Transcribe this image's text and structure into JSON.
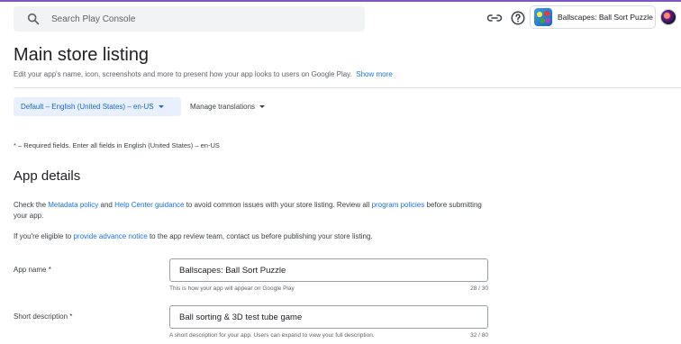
{
  "header": {
    "search_placeholder": "Search Play Console",
    "app_name": "Ballscapes: Ball Sort Puzzle"
  },
  "page": {
    "title": "Main store listing",
    "subtitle": "Edit your app's name, icon, screenshots and more to present how your app looks to users on Google Play.",
    "show_more": "Show more"
  },
  "language": {
    "selected": "Default – English (United States) – en-US",
    "manage_translations": "Manage translations"
  },
  "required_note": "* – Required fields. Enter all fields in English (United States) – en-US",
  "app_details": {
    "heading": "App details",
    "p1_a": "Check the ",
    "p1_link1": "Metadata policy",
    "p1_b": " and ",
    "p1_link2": "Help Center guidance",
    "p1_c": " to avoid common issues with your store listing. Review all ",
    "p1_link3": "program policies",
    "p1_d": " before submitting your app.",
    "p2_a": "If you're eligible to ",
    "p2_link": "provide advance notice",
    "p2_b": " to the app review team, contact us before publishing your store listing."
  },
  "fields": {
    "app_name": {
      "label": "App name  *",
      "value": "Ballscapes: Ball Sort Puzzle",
      "hint": "This is how your app will appear on Google Play",
      "counter": "28 / 30"
    },
    "short_description": {
      "label": "Short description  *",
      "value": "Ball sorting & 3D test tube game",
      "hint": "A short description for your app. Users can expand to view your full description.",
      "counter": "32 / 80"
    }
  },
  "icons": [
    "search-icon",
    "link-icon",
    "help-icon",
    "app-thumbnail",
    "avatar"
  ],
  "colors": {
    "accent": "#1a73e8",
    "top_bar": "#7e57c2",
    "chip_bg": "#e8f0fe"
  }
}
